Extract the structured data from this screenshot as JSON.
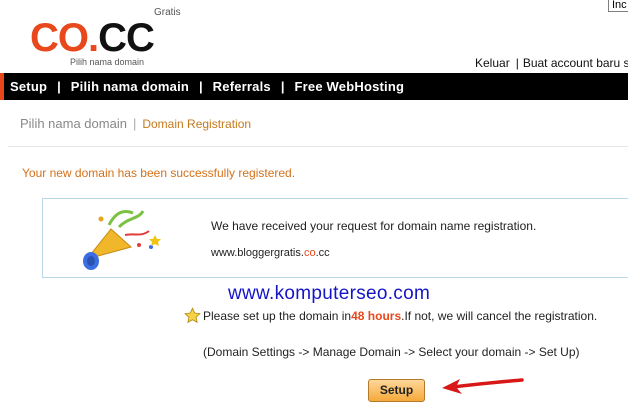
{
  "header": {
    "lang_select": "Inc",
    "logo": {
      "gratis": "Gratis",
      "co": "CO",
      "dot": ".",
      "cc": "CC",
      "tagline": "Pilih nama domain"
    },
    "account_links": {
      "logout": "Keluar",
      "separator": "|",
      "create": "Buat account baru s"
    }
  },
  "nav": {
    "items": [
      "Setup",
      "Pilih nama domain",
      "Referrals",
      "Free WebHosting"
    ],
    "separator": "|"
  },
  "breadcrumb": {
    "root": "Pilih nama domain",
    "separator": "|",
    "current": "Domain Registration"
  },
  "main": {
    "success_message": "Your new domain has been successfully registered.",
    "info_box": {
      "line1": "We have received your request for domain name registration.",
      "domain_prefix": "www.bloggergratis",
      "domain_dot1": ".",
      "domain_co": "co",
      "domain_dot2": ".",
      "domain_cc": "cc"
    },
    "watermark": "www.komputerseo.com",
    "notice": {
      "before": "Please set up the domain in ",
      "hours": "48 hours",
      "after": ".If not, we will cancel the registration."
    },
    "steps": "(Domain Settings -> Manage Domain -> Select your domain -> Set Up)",
    "setup_button": "Setup"
  },
  "colors": {
    "accent_orange": "#e8481c",
    "nav_bg": "#000000",
    "success_text": "#d4711a",
    "info_border": "#b9d6ea",
    "watermark_blue": "#1414c8",
    "annotation_arrow": "#d81818"
  },
  "icons": {
    "party": "party-popper-icon",
    "star": "star-icon",
    "arrow": "red-arrow-annotation"
  }
}
